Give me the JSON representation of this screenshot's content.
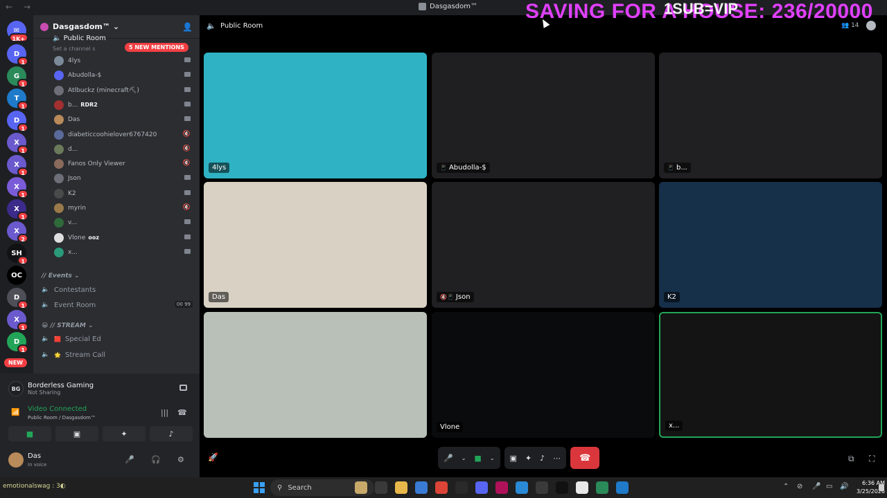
{
  "titlebar": {
    "title": "Dasgasdom™",
    "nav": "← →"
  },
  "overlay": {
    "banner": "SAVING FOR A HOUSE: 236/20000",
    "sub": "1SUB=VIP"
  },
  "rail": {
    "dm_badge": "1K+",
    "new_label": "NEW",
    "servers": [
      {
        "label": "D",
        "color": "#5865f2",
        "badge": "1"
      },
      {
        "label": "G",
        "color": "#2a8a5a",
        "badge": "1"
      },
      {
        "label": "T",
        "color": "#1f7ac9",
        "badge": "1"
      },
      {
        "label": "D",
        "color": "#5865f2",
        "badge": "1"
      },
      {
        "label": "X",
        "color": "#6a5acd",
        "badge": "1"
      },
      {
        "label": "X",
        "color": "#6a5acd",
        "badge": "1"
      },
      {
        "label": "X",
        "color": "#7a5cd8",
        "badge": "1"
      },
      {
        "label": "X",
        "color": "#3c2b8a",
        "badge": "1"
      },
      {
        "label": "X",
        "color": "#6a5acd",
        "badge": "2"
      },
      {
        "label": "SH",
        "color": "#111214",
        "badge": "1"
      },
      {
        "label": "OC",
        "color": "#000000",
        "badge": ""
      },
      {
        "label": "D",
        "color": "#4e5058",
        "badge": "1"
      },
      {
        "label": "X",
        "color": "#6a5acd",
        "badge": "1"
      },
      {
        "label": "D",
        "color": "#23a559",
        "badge": "1"
      }
    ]
  },
  "sidebar": {
    "guild": "Dasgasdom™",
    "pinned_channel": "Public Room",
    "topic": "Set a channel s",
    "mentions": "5 NEW MENTIONS",
    "voice_users": [
      {
        "name": "4lys",
        "activity": "",
        "color": "#7c8a9a",
        "cam": true
      },
      {
        "name": "Abudolla-$",
        "activity": "",
        "color": "#5865f2",
        "cam": true
      },
      {
        "name": "Atlbuckz (minecraft⛏)",
        "activity": "",
        "color": "#6d6f78",
        "cam": true
      },
      {
        "name": "b...",
        "activity": "RDR2",
        "color": "#a23030",
        "cam": true
      },
      {
        "name": "Das",
        "activity": "",
        "color": "#b98a5a",
        "cam": true
      },
      {
        "name": "diabeticcoohielover6767420",
        "activity": "",
        "color": "#5a6a9a",
        "cam": false
      },
      {
        "name": "d...",
        "activity": "",
        "color": "#6a7a5a",
        "cam": false
      },
      {
        "name": "Fanos Only Viewer",
        "activity": "",
        "color": "#8a6a5a",
        "cam": false
      },
      {
        "name": "Json",
        "activity": "",
        "color": "#6d6f78",
        "cam": true
      },
      {
        "name": "K2",
        "activity": "",
        "color": "#4a4a4a",
        "cam": true
      },
      {
        "name": "myrin",
        "activity": "",
        "color": "#9a7a4a",
        "cam": false
      },
      {
        "name": "v...",
        "activity": "",
        "color": "#2e6a3a",
        "cam": true
      },
      {
        "name": "Vlone",
        "activity": "ooz",
        "color": "#dedede",
        "cam": true
      },
      {
        "name": "x...",
        "activity": "",
        "color": "#2a9a7a",
        "cam": true
      }
    ],
    "events_category": "// Events",
    "events_channels": [
      {
        "name": "Contestants",
        "count_a": "",
        "count_b": ""
      },
      {
        "name": "Event Room",
        "count_a": "00",
        "count_b": "99"
      }
    ],
    "stream_category": "// STREAM",
    "stream_channels": [
      {
        "name": "Special Ed",
        "emoji": "🟥"
      },
      {
        "name": "Stream Call",
        "emoji": "🌟"
      }
    ]
  },
  "voicepanel": {
    "activity_name": "Borderless Gaming",
    "activity_status": "Not Sharing",
    "activity_logo": "BG",
    "connection": "Video Connected",
    "location": "Public Room / Dasgasdom™",
    "user_name": "Das",
    "user_status": "In voice"
  },
  "room": {
    "title": "Public Room",
    "people": "14"
  },
  "tiles": [
    {
      "name": "4lys",
      "prefix": "",
      "bg": "#2fb3c4"
    },
    {
      "name": "Abudolla-$",
      "prefix": "📱",
      "bg": "#1f1f21"
    },
    {
      "name": "b...",
      "prefix": "📱",
      "bg": "#202022"
    },
    {
      "name": "Das",
      "prefix": "",
      "bg": "#d8d1c4"
    },
    {
      "name": "Json",
      "prefix": "🔇📱",
      "bg": "#202022"
    },
    {
      "name": "K2",
      "prefix": "",
      "bg": "#16304a"
    },
    {
      "name": "",
      "prefix": "",
      "bg": "#b8c0b8"
    },
    {
      "name": "Vlone",
      "prefix": "",
      "bg": "#0a0b0c"
    },
    {
      "name": "x...",
      "prefix": "",
      "bg": "#141414"
    }
  ],
  "taskbar": {
    "ticker": "emotionalswag : 3◐",
    "search": "Search",
    "time": "6:36 AM",
    "date": "3/25/2026"
  }
}
